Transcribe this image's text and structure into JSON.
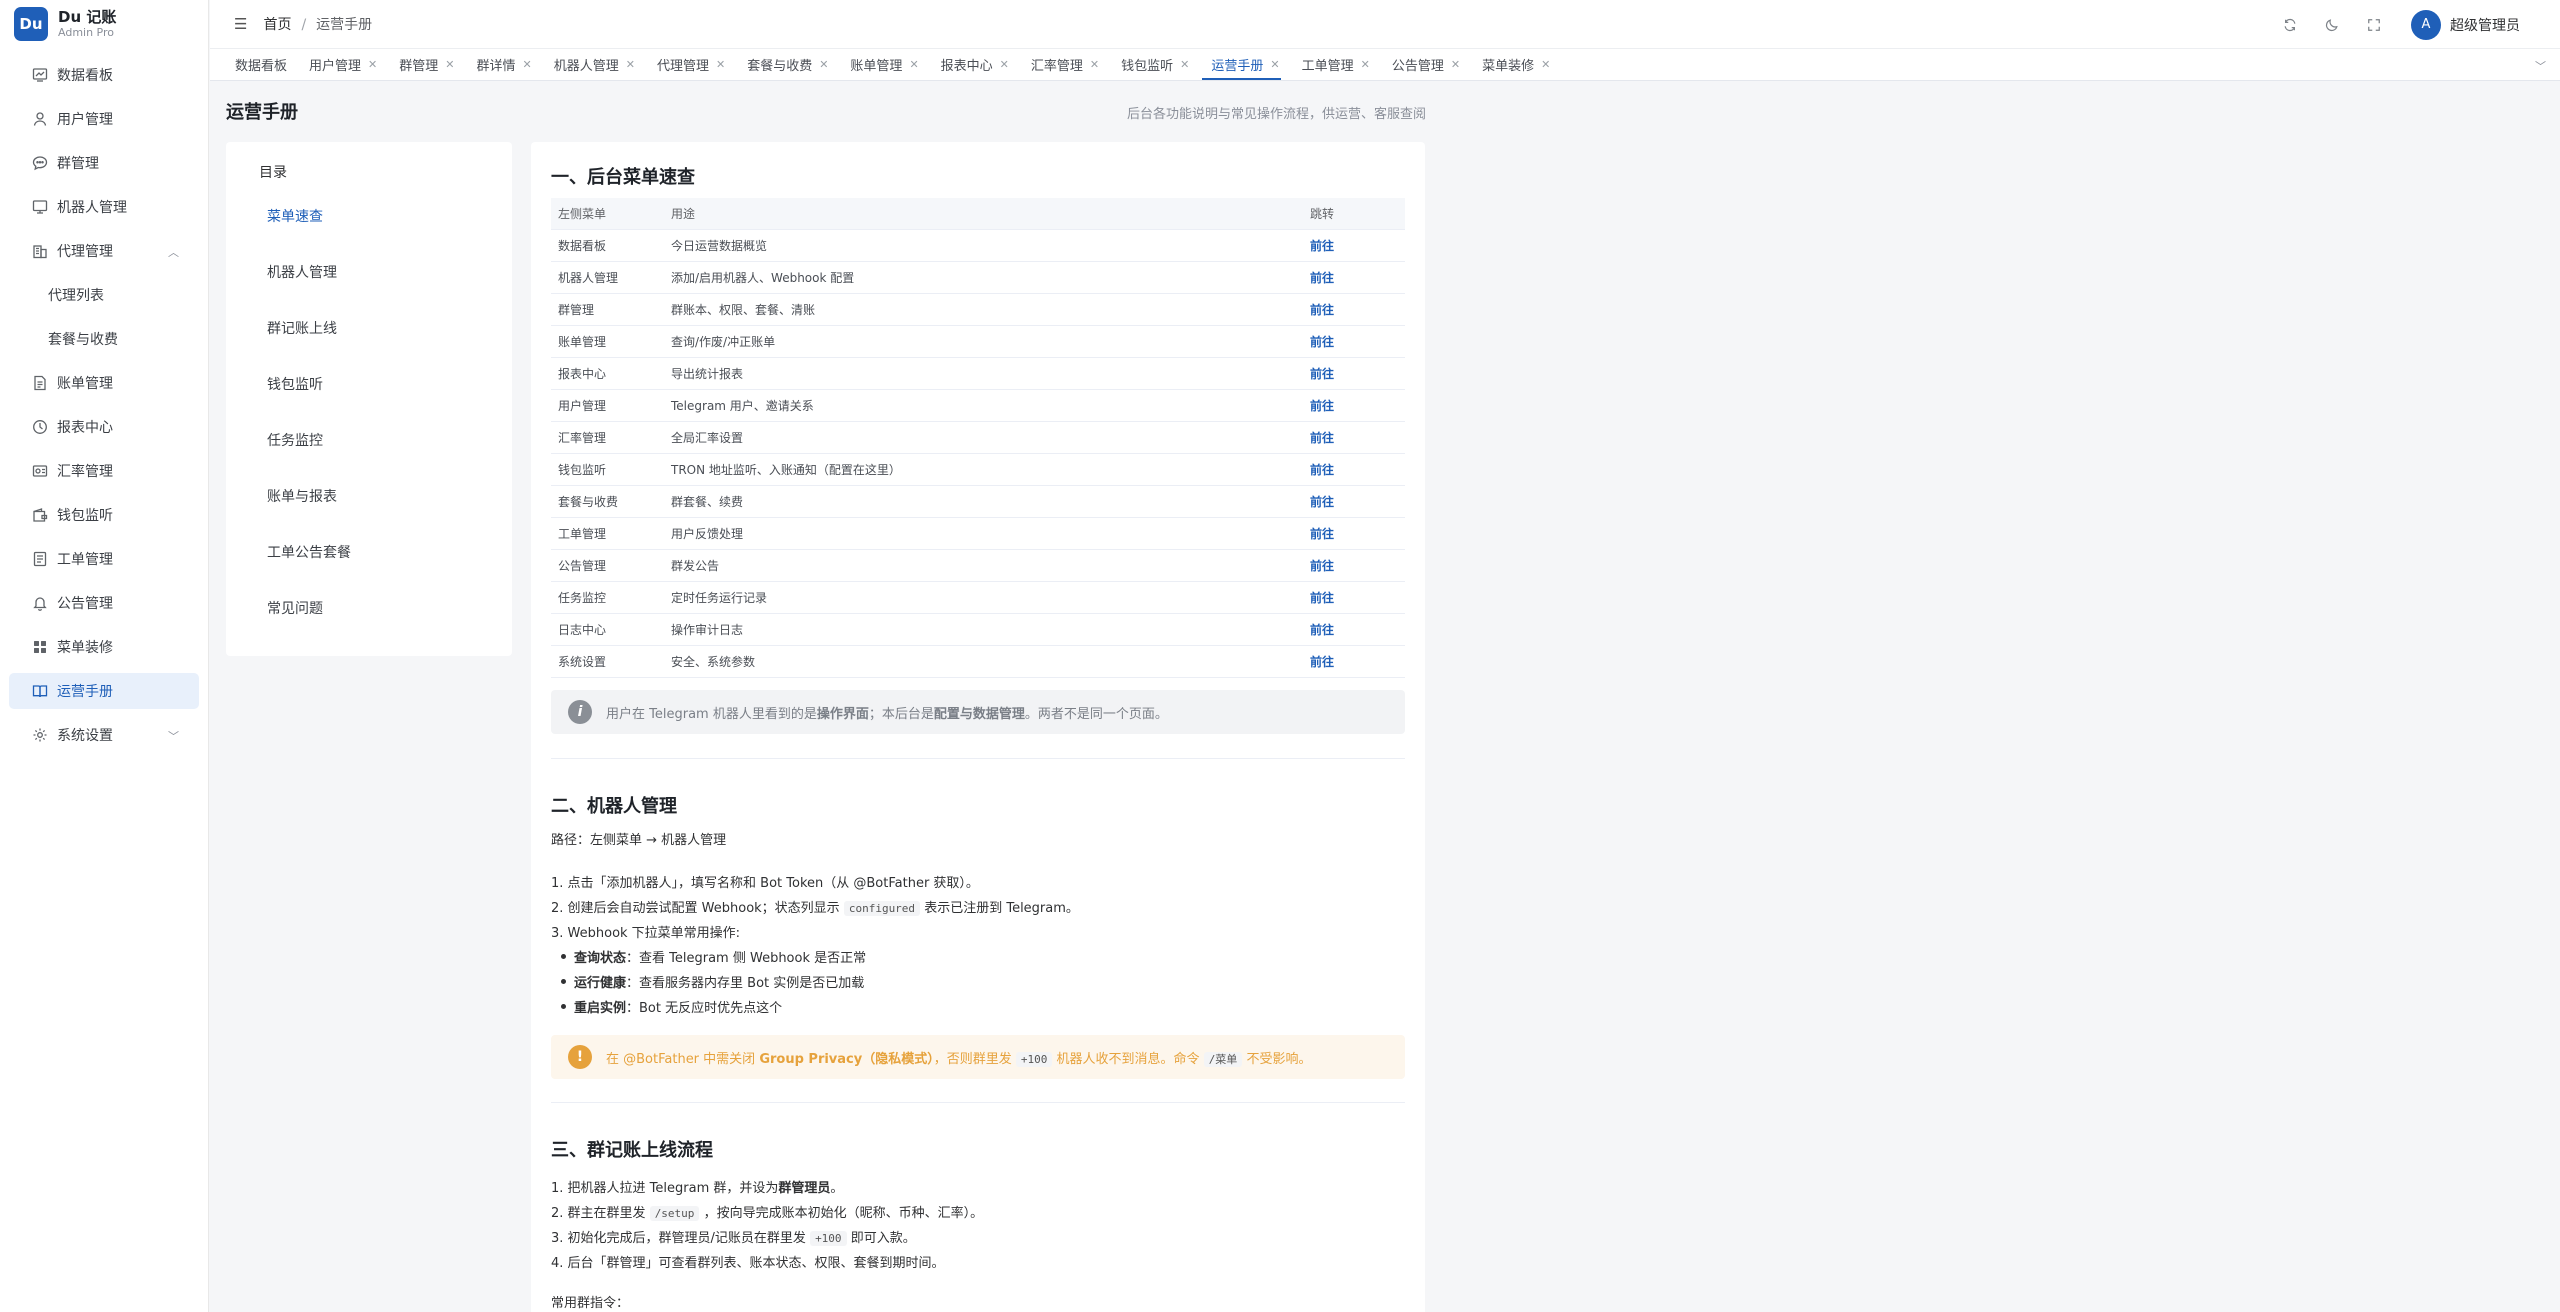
{
  "brand": {
    "logo": "Du",
    "name": "Du 记账",
    "sub": "Admin Pro"
  },
  "sidebar": {
    "items": [
      {
        "label": "数据看板",
        "icon": "dashboard-icon"
      },
      {
        "label": "用户管理",
        "icon": "user-icon"
      },
      {
        "label": "群管理",
        "icon": "chat-icon"
      },
      {
        "label": "机器人管理",
        "icon": "monitor-icon"
      },
      {
        "label": "代理管理",
        "icon": "building-icon"
      },
      {
        "label": "代理列表"
      },
      {
        "label": "套餐与收费"
      },
      {
        "label": "账单管理",
        "icon": "document-icon"
      },
      {
        "label": "报表中心",
        "icon": "clock-icon"
      },
      {
        "label": "汇率管理",
        "icon": "exchange-icon"
      },
      {
        "label": "钱包监听",
        "icon": "wallet-icon"
      },
      {
        "label": "工单管理",
        "icon": "ticket-icon"
      },
      {
        "label": "公告管理",
        "icon": "bell-icon"
      },
      {
        "label": "菜单装修",
        "icon": "grid-icon"
      },
      {
        "label": "运营手册",
        "icon": "book-icon"
      },
      {
        "label": "系统设置",
        "icon": "gear-icon"
      }
    ]
  },
  "header": {
    "breadcrumb_home": "首页",
    "breadcrumb_sep": "/",
    "breadcrumb_current": "运营手册",
    "avatar": "A",
    "user": "超级管理员"
  },
  "tabs": [
    {
      "label": "数据看板",
      "closable": false
    },
    {
      "label": "用户管理",
      "closable": true
    },
    {
      "label": "群管理",
      "closable": true
    },
    {
      "label": "群详情",
      "closable": true
    },
    {
      "label": "机器人管理",
      "closable": true
    },
    {
      "label": "代理管理",
      "closable": true
    },
    {
      "label": "套餐与收费",
      "closable": true
    },
    {
      "label": "账单管理",
      "closable": true
    },
    {
      "label": "报表中心",
      "closable": true
    },
    {
      "label": "汇率管理",
      "closable": true
    },
    {
      "label": "钱包监听",
      "closable": true
    },
    {
      "label": "运营手册",
      "closable": true
    },
    {
      "label": "工单管理",
      "closable": true
    },
    {
      "label": "公告管理",
      "closable": true
    },
    {
      "label": "菜单装修",
      "closable": true
    }
  ],
  "page": {
    "title": "运营手册",
    "desc": "后台各功能说明与常见操作流程，供运营、客服查阅"
  },
  "toc": {
    "title": "目录",
    "items": [
      "菜单速查",
      "机器人管理",
      "群记账上线",
      "钱包监听",
      "任务监控",
      "账单与报表",
      "工单公告套餐",
      "常见问题"
    ]
  },
  "section1": {
    "title": "一、后台菜单速查",
    "headers": [
      "左侧菜单",
      "用途",
      "跳转"
    ],
    "link_label": "前往",
    "rows": [
      [
        "数据看板",
        "今日运营数据概览"
      ],
      [
        "机器人管理",
        "添加/启用机器人、Webhook 配置"
      ],
      [
        "群管理",
        "群账本、权限、套餐、清账"
      ],
      [
        "账单管理",
        "查询/作废/冲正账单"
      ],
      [
        "报表中心",
        "导出统计报表"
      ],
      [
        "用户管理",
        "Telegram 用户、邀请关系"
      ],
      [
        "汇率管理",
        "全局汇率设置"
      ],
      [
        "钱包监听",
        "TRON 地址监听、入账通知（配置在这里）"
      ],
      [
        "套餐与收费",
        "群套餐、续费"
      ],
      [
        "工单管理",
        "用户反馈处理"
      ],
      [
        "公告管理",
        "群发公告"
      ],
      [
        "任务监控",
        "定时任务运行记录"
      ],
      [
        "日志中心",
        "操作审计日志"
      ],
      [
        "系统设置",
        "安全、系统参数"
      ]
    ],
    "note_pre": "用户在 Telegram 机器人里看到的是",
    "note_b1": "操作界面",
    "note_mid": "；本后台是",
    "note_b2": "配置与数据管理",
    "note_post": "。两者不是同一个页面。"
  },
  "section2": {
    "title": "二、机器人管理",
    "path": "路径：左侧菜单 → 机器人管理",
    "step1": "1. 点击「添加机器人」，填写名称和 Bot Token（从 @BotFather 获取）。",
    "step2_pre": "2. 创建后会自动尝试配置 Webhook；状态列显示",
    "step2_code": "configured",
    "step2_post": "表示已注册到 Telegram。",
    "step3": "3. Webhook 下拉菜单常用操作:",
    "b1_key": "查询状态",
    "b1_val": "：查看 Telegram 侧 Webhook 是否正常",
    "b2_key": "运行健康",
    "b2_val": "：查看服务器内存里 Bot 实例是否已加载",
    "b3_key": "重启实例",
    "b3_val": "：Bot 无反应时优先点这个",
    "warn_pre": "在 @BotFather 中需关闭",
    "warn_b": "Group Privacy（隐私模式）",
    "warn_mid": "，否则群里发",
    "warn_code1": "+100",
    "warn_mid2": "机器人收不到消息。命令",
    "warn_code2": "/菜单",
    "warn_post": "不受影响。"
  },
  "section3": {
    "title": "三、群记账上线流程",
    "step1_pre": "1. 把机器人拉进 Telegram 群，并设为",
    "step1_b": "群管理员",
    "step1_post": "。",
    "step2_pre": "2. 群主在群里发",
    "step2_code": "/setup",
    "step2_post": "，按向导完成账本初始化（昵称、币种、汇率）。",
    "step3_pre": "3. 初始化完成后，群管理员/记账员在群里发",
    "step3_code": "+100",
    "step3_post": "即可入款。",
    "step4": "4. 后台「群管理」可查看群列表、账本状态、权限、套餐到期时间。",
    "cmd_title": "常用群指令："
  }
}
